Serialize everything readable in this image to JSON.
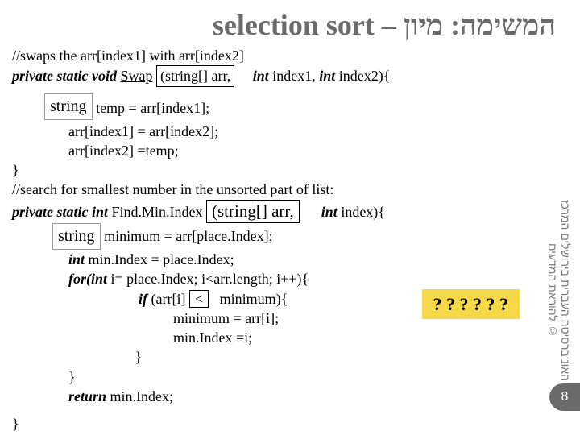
{
  "title": {
    "en": "selection sort – ",
    "he": "המשימה: מיון"
  },
  "code": {
    "c1": "//swaps the arr[index1] with arr[index2]",
    "c2a": "private static void",
    "c2b": "Swap",
    "c2c": "(string[] arr,",
    "c2d": "int",
    "c2e": " index1, ",
    "c2f": "int",
    "c2g": " index2){",
    "badge_string1": "string",
    "c3": " temp = arr[index1];",
    "c4": "arr[index1] = arr[index2];",
    "c5": "arr[index2] =temp;",
    "c6": "}",
    "c7": "//search for smallest number in the unsorted part of list:",
    "c8a": "private static int",
    "c8b": " Find.Min.Index",
    "c8c": "(string[] arr,",
    "c8d": "int",
    "c8e": " index){",
    "badge_string2": "string",
    "c9": " minimum = arr[place.Index];",
    "c10a": "int ",
    "c10b": "min.Index = place.Index;",
    "c11a": "for",
    "c11b": "(int",
    "c11c": " i= place.Index; i<arr.length; i++){",
    "c12a": "if",
    "c12b": " (arr[i] ",
    "c12_lt": "<",
    "c12c": " minimum){",
    "yellow": "? ? ? ? ? ?",
    "c13": "minimum = arr[i];",
    "c14": "min.Index =i;",
    "c15": "}",
    "c16": "}",
    "c17a": "return",
    "c17b": " min.Index;",
    "c18": "}"
  },
  "side": "האוניברסיטה העברית בירושלים   המרכז להוראת המדעים ©",
  "page": "8"
}
